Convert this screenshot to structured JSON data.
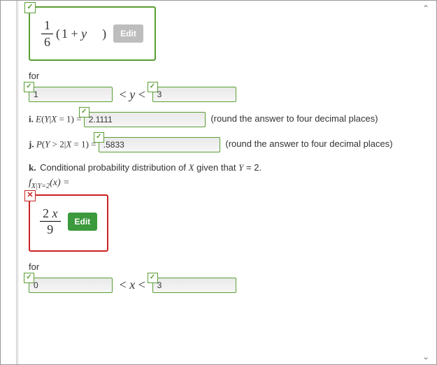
{
  "expr1": {
    "frac_num": "1",
    "frac_den": "6",
    "paren_text": "1 + y",
    "edit": "Edit"
  },
  "for_label": "for",
  "range1": {
    "low": "1",
    "mid": "< y <",
    "high": "3"
  },
  "line_i": {
    "label": "i.",
    "lhs": "E(Y|X = 1) =",
    "value": "2.1111",
    "note": "(round the answer to four decimal places)"
  },
  "line_j": {
    "label": "j.",
    "lhs": "P(Y > 2|X = 1) =",
    "value": ".5833",
    "note": "(round the answer to four decimal places)"
  },
  "line_k": {
    "label": "k.",
    "text": "Conditional probability distribution of X given that Y = 2."
  },
  "fx_label": {
    "f": "f",
    "sub": "X|Y=2",
    "arg": "(x) ="
  },
  "expr2": {
    "frac_num": "2 x",
    "frac_den": "9",
    "edit": "Edit"
  },
  "range2": {
    "low": "0",
    "mid": "< x <",
    "high": "3"
  },
  "tick_ok": "✓",
  "tick_bad": "✕"
}
